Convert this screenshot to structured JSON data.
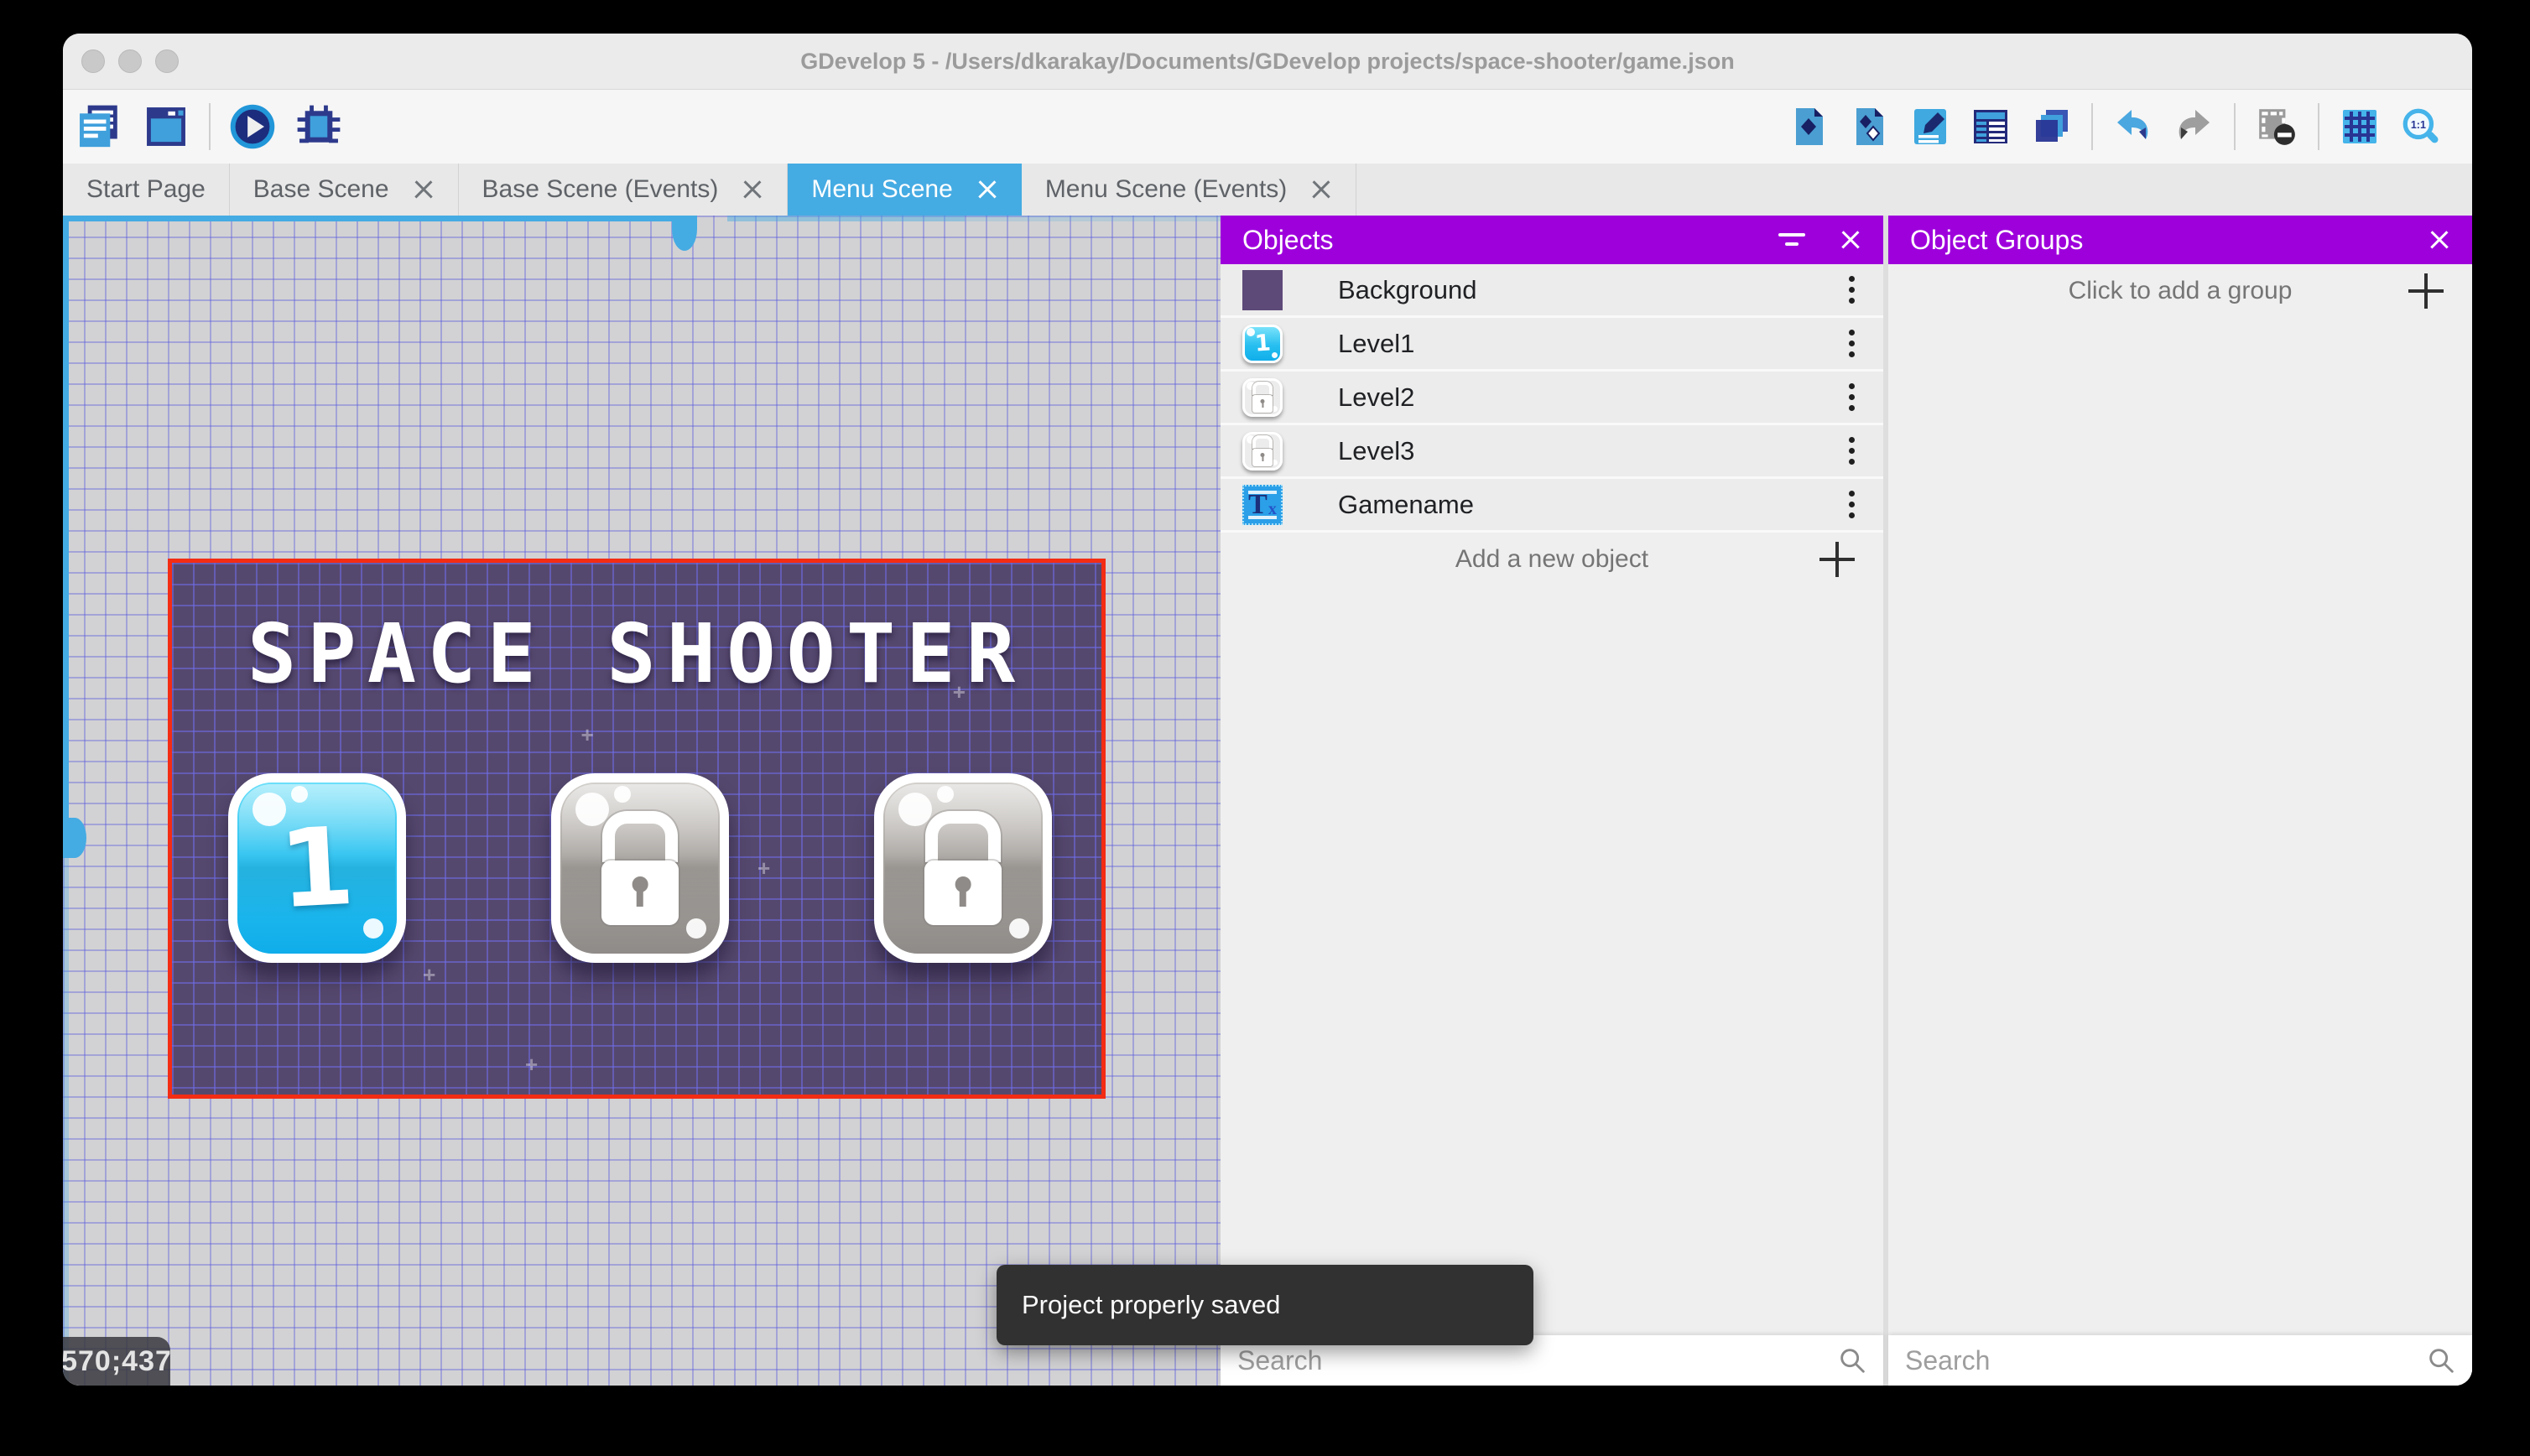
{
  "window": {
    "title": "GDevelop 5 - /Users/dkarakay/Documents/GDevelop projects/space-shooter/game.json"
  },
  "toolbar": {
    "zoom_reset_label": "1:1"
  },
  "tabs": [
    {
      "label": "Start Page",
      "closable": false,
      "active": false
    },
    {
      "label": "Base Scene",
      "closable": true,
      "active": false
    },
    {
      "label": "Base Scene (Events)",
      "closable": true,
      "active": false
    },
    {
      "label": "Menu Scene",
      "closable": true,
      "active": true
    },
    {
      "label": "Menu Scene (Events)",
      "closable": true,
      "active": false
    }
  ],
  "canvas": {
    "coordinates": "570;437",
    "scene": {
      "title": "SPACE SHOOTER",
      "level_buttons": [
        {
          "label": "1",
          "locked": false
        },
        {
          "label": "",
          "locked": true
        },
        {
          "label": "",
          "locked": true
        }
      ]
    }
  },
  "toast": {
    "message": "Project properly saved"
  },
  "objects_panel": {
    "title": "Objects",
    "items": [
      {
        "name": "Background",
        "thumb": "background",
        "thumb_label": ""
      },
      {
        "name": "Level1",
        "thumb": "level-unlocked",
        "thumb_label": "1"
      },
      {
        "name": "Level2",
        "thumb": "level-locked",
        "thumb_label": ""
      },
      {
        "name": "Level3",
        "thumb": "level-locked",
        "thumb_label": ""
      },
      {
        "name": "Gamename",
        "thumb": "text-object",
        "thumb_label": "Tx"
      }
    ],
    "add_label": "Add a new object",
    "search_placeholder": "Search"
  },
  "groups_panel": {
    "title": "Object Groups",
    "empty_label": "Click to add a group",
    "search_placeholder": "Search"
  },
  "colors": {
    "accent_blue": "#45abe3",
    "header_purple": "#9e00dc",
    "scene_border_red": "#f32c14",
    "scene_background": "#55486e"
  }
}
